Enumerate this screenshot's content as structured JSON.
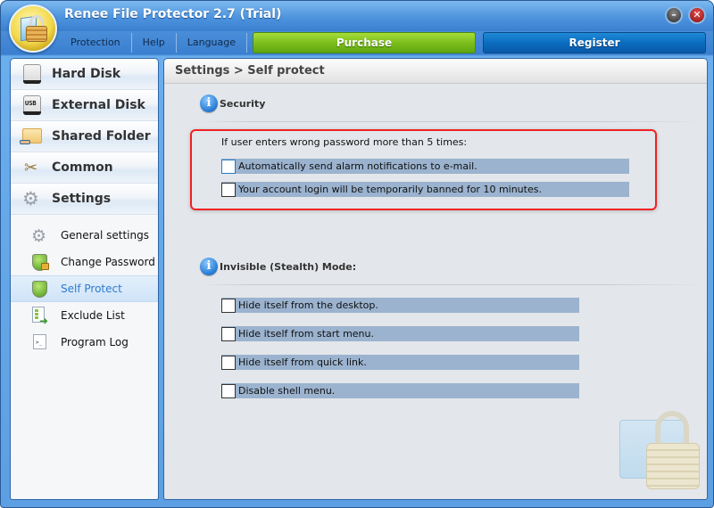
{
  "window": {
    "title": "Renee File Protector 2.7 (Trial)",
    "minimize_glyph": "–",
    "close_glyph": "✕"
  },
  "menu": {
    "items": [
      "Protection",
      "Help",
      "Language"
    ],
    "purchase_label": "Purchase",
    "register_label": "Register"
  },
  "colors": {
    "purchase": "#7cbf1c",
    "register": "#0b6cc0",
    "highlight_box": "#ee2222",
    "active_nav_text": "#2f7ad0",
    "option_row_bg": "#9bb3cf"
  },
  "sidebar": {
    "main_items": [
      {
        "label": "Hard Disk",
        "icon": "hard-disk-icon"
      },
      {
        "label": "External Disk",
        "icon": "usb-disk-icon",
        "icon_text": "USB"
      },
      {
        "label": "Shared Folder",
        "icon": "shared-folder-icon"
      },
      {
        "label": "Common",
        "icon": "tools-icon"
      },
      {
        "label": "Settings",
        "icon": "gear-icon"
      }
    ],
    "sub_items": [
      {
        "label": "General settings",
        "icon": "gear-icon",
        "active": false
      },
      {
        "label": "Change Password",
        "icon": "shield-lock-icon",
        "active": false
      },
      {
        "label": "Self Protect",
        "icon": "shield-icon",
        "active": true
      },
      {
        "label": "Exclude List",
        "icon": "exclude-list-icon",
        "active": false
      },
      {
        "label": "Program Log",
        "icon": "program-log-icon",
        "active": false
      }
    ]
  },
  "content": {
    "breadcrumb": "Settings > Self protect",
    "security": {
      "title": "Security",
      "lead": "If user enters wrong password more than 5 times:",
      "options": [
        {
          "label": "Automatically send alarm notifications to e-mail.",
          "checked": false
        },
        {
          "label": "Your account login will be temporarily banned for 10 minutes.",
          "checked": false
        }
      ]
    },
    "stealth": {
      "title": "Invisible (Stealth) Mode:",
      "options": [
        {
          "label": "Hide itself from the desktop.",
          "checked": false
        },
        {
          "label": "Hide itself from start menu.",
          "checked": false
        },
        {
          "label": "Hide itself from quick link.",
          "checked": false
        },
        {
          "label": "Disable shell menu.",
          "checked": false
        }
      ]
    }
  }
}
